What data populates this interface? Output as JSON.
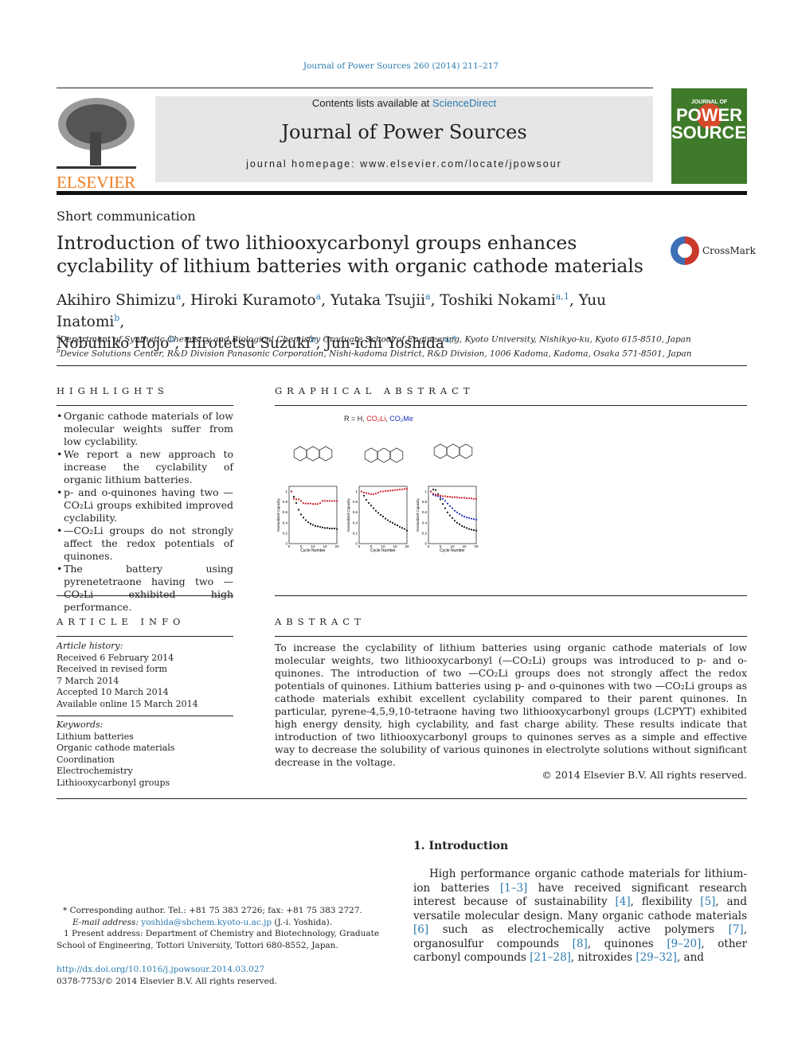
{
  "header": {
    "citation": "Journal of Power Sources 260 (2014) 211–217",
    "contents_prefix": "Contents lists available at ",
    "sciencedirect": "ScienceDirect",
    "journal_title": "Journal of Power Sources",
    "homepage": "journal homepage: www.elsevier.com/locate/jpowsour",
    "publisher_logo": "ELSEVIER",
    "cover_text": [
      "JOURNAL OF",
      "POWER",
      "SOURCES"
    ]
  },
  "article": {
    "type": "Short communication",
    "title": "Introduction of two lithiooxycarbonyl groups enhances cyclability of lithium batteries with organic cathode materials",
    "crossmark": "CrossMark",
    "authors": [
      {
        "name": "Akihiro Shimizu",
        "sup": "a"
      },
      {
        "name": "Hiroki Kuramoto",
        "sup": "a"
      },
      {
        "name": "Yutaka Tsujii",
        "sup": "a"
      },
      {
        "name": "Toshiki Nokami",
        "sup": "a,1"
      },
      {
        "name": "Yuu Inatomi",
        "sup": "b"
      },
      {
        "name": "Nobuhiko Hojo",
        "sup": "b"
      },
      {
        "name": "Hirotetsu Suzuki",
        "sup": "b"
      },
      {
        "name": "Jun-ichi Yoshida",
        "sup": "a,*"
      }
    ],
    "affiliations": [
      {
        "sup": "a",
        "text": "Department of Synthetic Chemistry and Biological Chemistry Graduate School of Engineering, Kyoto University, Nishikyo-ku, Kyoto 615-8510, Japan"
      },
      {
        "sup": "b",
        "text": "Device Solutions Center, R&D Division Panasonic Corporation, Nishi-kadoma District, R&D Division, 1006 Kadoma, Kadoma, Osaka 571-8501, Japan"
      }
    ]
  },
  "highlights": {
    "heading": "HIGHLIGHTS",
    "items": [
      "Organic cathode materials of low molecular weights suffer from low cyclability.",
      "We report a new approach to increase the cyclability of organic lithium batteries.",
      "p- and o-quinones having two —CO₂Li groups exhibited improved cyclability.",
      "—CO₂Li groups do not strongly affect the redox potentials of quinones.",
      "The battery using pyrenetetraone having two —CO₂Li exhibited high performance."
    ]
  },
  "graphical_abstract": {
    "heading": "GRAPHICAL ABSTRACT",
    "legend": {
      "prefix": "R = H, ",
      "r1": "CO₂Li",
      "sep": ", ",
      "r2": "CO₂Me"
    },
    "colors": {
      "H": "#111111",
      "CO2Li": "#d0202a",
      "CO2Me": "#2030c0"
    },
    "xlabel": "Cycle Number",
    "ylabel": "Normalized Capacity",
    "yticks": [
      "0",
      "0.2",
      "0.4",
      "0.6",
      "0.8",
      "1"
    ],
    "xticks": [
      "0",
      "5",
      "10",
      "15",
      "20"
    ],
    "plots": [
      {
        "series": [
          {
            "key": "H",
            "values": [
              1,
              0.9,
              0.78,
              0.65,
              0.56,
              0.5,
              0.45,
              0.41,
              0.38,
              0.36,
              0.34,
              0.33,
              0.32,
              0.31,
              0.3,
              0.3,
              0.29,
              0.29,
              0.29,
              0.28
            ]
          },
          {
            "key": "CO2Li",
            "values": [
              1,
              0.86,
              0.85,
              0.85,
              0.82,
              0.78,
              0.77,
              0.77,
              0.77,
              0.76,
              0.76,
              0.76,
              0.78,
              0.82,
              0.82,
              0.82,
              0.82,
              0.82,
              0.82,
              0.82
            ]
          }
        ]
      },
      {
        "series": [
          {
            "key": "H",
            "values": [
              1,
              0.92,
              0.84,
              0.78,
              0.73,
              0.68,
              0.63,
              0.59,
              0.55,
              0.52,
              0.48,
              0.45,
              0.42,
              0.4,
              0.37,
              0.35,
              0.32,
              0.3,
              0.28,
              0.25
            ]
          },
          {
            "key": "CO2Li",
            "values": [
              1,
              0.98,
              0.97,
              0.96,
              0.95,
              0.95,
              0.96,
              0.98,
              1,
              1,
              1.01,
              1.01,
              1.02,
              1.02,
              1.03,
              1.03,
              1.04,
              1.04,
              1.05,
              1.05
            ]
          }
        ]
      },
      {
        "series": [
          {
            "key": "H",
            "values": [
              1,
              1.04,
              1.03,
              0.95,
              0.85,
              0.76,
              0.68,
              0.6,
              0.54,
              0.49,
              0.44,
              0.4,
              0.37,
              0.34,
              0.32,
              0.3,
              0.28,
              0.27,
              0.26,
              0.25
            ]
          },
          {
            "key": "CO2Me",
            "values": [
              1,
              0.94,
              0.92,
              0.91,
              0.89,
              0.86,
              0.82,
              0.77,
              0.72,
              0.68,
              0.63,
              0.6,
              0.57,
              0.54,
              0.52,
              0.5,
              0.49,
              0.48,
              0.47,
              0.46
            ]
          },
          {
            "key": "CO2Li",
            "values": [
              1,
              0.96,
              0.94,
              0.93,
              0.92,
              0.91,
              0.91,
              0.9,
              0.9,
              0.89,
              0.89,
              0.89,
              0.88,
              0.88,
              0.88,
              0.87,
              0.87,
              0.87,
              0.86,
              0.86
            ]
          }
        ]
      }
    ]
  },
  "article_info": {
    "heading": "ARTICLE INFO",
    "history_label": "Article history:",
    "history": [
      "Received 6 February 2014",
      "Received in revised form",
      "7 March 2014",
      "Accepted 10 March 2014",
      "Available online 15 March 2014"
    ],
    "keywords_label": "Keywords:",
    "keywords": [
      "Lithium batteries",
      "Organic cathode materials",
      "Coordination",
      "Electrochemistry",
      "Lithiooxycarbonyl groups"
    ]
  },
  "abstract": {
    "heading": "ABSTRACT",
    "text": "To increase the cyclability of lithium batteries using organic cathode materials of low molecular weights, two lithiooxycarbonyl (—CO₂Li) groups was introduced to p- and o-quinones. The introduction of two —CO₂Li groups does not strongly affect the redox potentials of quinones. Lithium batteries using p- and o-quinones with two —CO₂Li groups as cathode materials exhibit excellent cyclability compared to their parent quinones. In particular, pyrene-4,5,9,10-tetraone having two lithiooxycarbonyl groups (LCPYT) exhibited high energy density, high cyclability, and fast charge ability. These results indicate that introduction of two lithiooxycarbonyl groups to quinones serves as a simple and effective way to decrease the solubility of various quinones in electrolyte solutions without significant decrease in the voltage.",
    "copyright": "© 2014 Elsevier B.V. All rights reserved."
  },
  "introduction": {
    "heading": "1.  Introduction",
    "parts": [
      "High performance organic cathode materials for lithium-ion batteries ",
      "[1–3]",
      " have received significant research interest because of sustainability ",
      "[4]",
      ", flexibility ",
      "[5]",
      ", and versatile molecular design. Many organic cathode materials ",
      "[6]",
      " such as electrochemically active polymers ",
      "[7]",
      ", organosulfur compounds ",
      "[8]",
      ", quinones ",
      "[9–20]",
      ", other carbonyl compounds ",
      "[21–28]",
      ", nitroxides ",
      "[29–32]",
      ", and"
    ]
  },
  "footnotes": {
    "corresponding": "* Corresponding author. Tel.: +81 75 383 2726; fax: +81 75 383 2727.",
    "email_label": "E-mail address: ",
    "email": "yoshida@sbchem.kyoto-u.ac.jp",
    "email_suffix": " (J.-i. Yoshida).",
    "present": "1  Present address: Department of Chemistry and Biotechnology, Graduate School of Engineering, Tottori University, Tottori 680-8552, Japan.",
    "doi": "http://dx.doi.org/10.1016/j.jpowsour.2014.03.027",
    "issn": "0378-7753/© 2014 Elsevier B.V. All rights reserved."
  }
}
